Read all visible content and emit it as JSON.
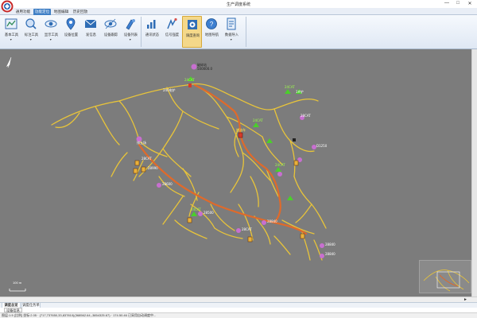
{
  "window": {
    "title": "生产调度系统",
    "controls": {
      "minimize": "—",
      "maximize": "□",
      "close": "✕"
    }
  },
  "menu_tabs": [
    {
      "label": "通用功能",
      "active": false
    },
    {
      "label": "功能定位",
      "active": true
    },
    {
      "label": "地图编辑",
      "active": false
    },
    {
      "label": "历史回放",
      "active": false
    }
  ],
  "ribbon": {
    "group1": [
      {
        "label": "基本工具",
        "icon": "map-tools-icon"
      },
      {
        "label": "标注工具",
        "icon": "annotation-icon"
      },
      {
        "label": "显示工具",
        "icon": "display-eye-icon"
      },
      {
        "label": "设备位置",
        "icon": "device-position-icon"
      },
      {
        "label": "发信息",
        "icon": "send-message-icon"
      },
      {
        "label": "设备跟踪",
        "icon": "device-track-icon"
      },
      {
        "label": "设备列表",
        "icon": "device-list-icon"
      }
    ],
    "group2": [
      {
        "label": "通讯状态",
        "icon": "comm-status-icon"
      },
      {
        "label": "信号强度",
        "icon": "signal-icon"
      },
      {
        "label": "调度查询",
        "icon": "dispatch-query-icon"
      },
      {
        "label": "地图导航",
        "icon": "map-navigation-icon"
      },
      {
        "label": "数据导入",
        "icon": "data-import-icon"
      }
    ]
  },
  "map": {
    "scale": "100 m",
    "labels": [
      {
        "text": "破碎站\n500000.0",
        "color": "dark"
      },
      {
        "text": "240电铲",
        "color": "dark"
      },
      {
        "text": "24CAT",
        "color": "white"
      },
      {
        "text": "24CAT",
        "color": "white"
      },
      {
        "text": "1#铲",
        "color": "white"
      },
      {
        "text": "排土场",
        "color": "white"
      },
      {
        "text": "D1250",
        "color": "white"
      },
      {
        "text": "28CAT",
        "color": "white"
      },
      {
        "text": "24CAT",
        "color": "white"
      },
      {
        "text": "28CAT",
        "color": "white"
      },
      {
        "text": "24CAT",
        "color": "white"
      },
      {
        "text": "28990",
        "color": "white"
      },
      {
        "text": "28600",
        "color": "white"
      },
      {
        "text": "24CAT",
        "color": "white"
      },
      {
        "text": "28500",
        "color": "white"
      },
      {
        "text": "28840",
        "color": "white"
      },
      {
        "text": "28CAT",
        "color": "white"
      },
      {
        "text": "28840",
        "color": "white"
      },
      {
        "text": "28840",
        "color": "white"
      },
      {
        "text": "加油车",
        "color": "yellow"
      }
    ]
  },
  "bottom_tabs": [
    {
      "label": "调度总览 ▣",
      "active": true
    },
    {
      "label": "调度任务单",
      "active": false
    }
  ],
  "subtab": "设备信息",
  "status_text": "图层:1:5 [比例] 坐标:2.05 · (717,737650,33,837810)(368562.64,-3854325.67) · 174.50.46 已采用自动调度中..."
}
